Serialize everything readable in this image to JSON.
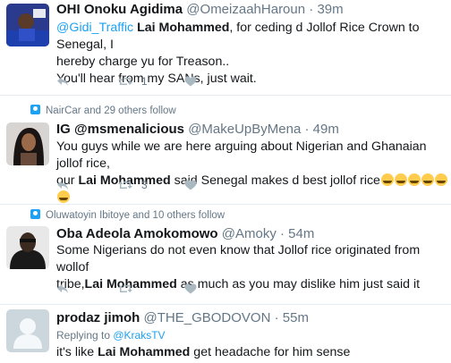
{
  "tweets": [
    {
      "name": "OHI Onoku Agidima",
      "handle": "@OmeizaahHaroun",
      "time": "39m",
      "social": "",
      "reply_to": "",
      "text": {
        "mention": "@Gidi_Traffic",
        "bold": "Lai Mohammed",
        "line1_rest": ", for ceding d Jollof Rice Crown to Senegal, I",
        "line2": "hereby charge yu for Treason..",
        "line3": "You'll hear from my SANs, just wait."
      },
      "retweets": "1",
      "likes": ""
    },
    {
      "name": "IG @msmenalicious",
      "handle": "@MakeUpByMena",
      "time": "49m",
      "social": "NairCar and 29 others follow",
      "reply_to": "",
      "text": {
        "line1": "You guys while we are here arguing about Nigerian and Ghanaian jollof rice,",
        "line2_pre": "our ",
        "bold": "Lai Mohammed",
        "line2_post": " said Senegal makes d best jollof rice",
        "emoji_count": 6
      },
      "retweets": "3",
      "likes": ""
    },
    {
      "name": "Oba Adeola Amokomowo",
      "handle": "@Amoky",
      "time": "54m",
      "social": "Oluwatoyin Ibitoye and 10 others follow",
      "reply_to": "",
      "text": {
        "line1": "Some Nigerians do not even know that Jollof rice originated from wollof",
        "line2_pre": "tribe,",
        "bold": "Lai Mohammed",
        "line2_post": " as much as you may dislike him just said it"
      },
      "retweets": "",
      "likes": ""
    },
    {
      "name": "prodaz jimoh",
      "handle": "@THE_GBODOVON",
      "time": "55m",
      "social": "",
      "reply_prefix": "Replying to ",
      "reply_to": "@KraksTV",
      "text": {
        "line1_pre": "it's like ",
        "bold": "Lai Mohammed",
        "line1_post": " get headache for him sense"
      },
      "retweets": "",
      "likes": ""
    }
  ],
  "colors": {
    "accent": "#1da1f2",
    "muted": "#657786",
    "icon": "#aab8c2",
    "separator": "#e6ecf0"
  },
  "icons": [
    "reply-icon",
    "retweet-icon",
    "like-icon",
    "follow-context-icon"
  ]
}
